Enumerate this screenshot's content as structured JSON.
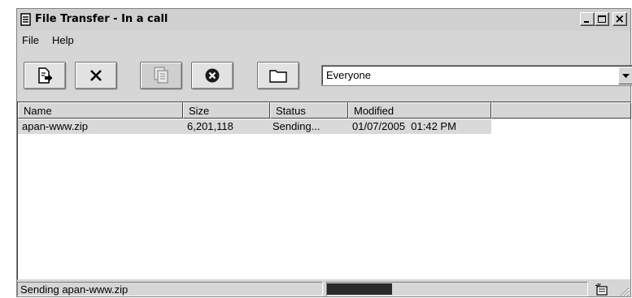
{
  "window": {
    "title": "File Transfer - In a call"
  },
  "menu": {
    "items": [
      "File",
      "Help"
    ]
  },
  "toolbar": {
    "buttons": [
      {
        "name": "send-file",
        "icon": "send-file-icon",
        "enabled": true
      },
      {
        "name": "cancel",
        "icon": "close-x-icon",
        "enabled": true
      },
      {
        "name": "send-all",
        "icon": "send-all-files-icon",
        "enabled": false
      },
      {
        "name": "stop",
        "icon": "stop-icon",
        "enabled": true
      },
      {
        "name": "open-folder",
        "icon": "folder-icon",
        "enabled": true
      }
    ]
  },
  "recipient": {
    "selected": "Everyone"
  },
  "table": {
    "columns": [
      "Name",
      "Size",
      "Status",
      "Modified"
    ],
    "rows": [
      {
        "name": "apan-www.zip",
        "size": "6,201,118",
        "status": "Sending...",
        "modified": "01/07/2005  01:42 PM"
      }
    ]
  },
  "statusbar": {
    "text": "Sending apan-www.zip",
    "progress_fraction": 0.25
  },
  "colors": {
    "window_bg": "#d6d6d6",
    "selection": "#d9d9d9",
    "progress": "#2a2a2a"
  }
}
